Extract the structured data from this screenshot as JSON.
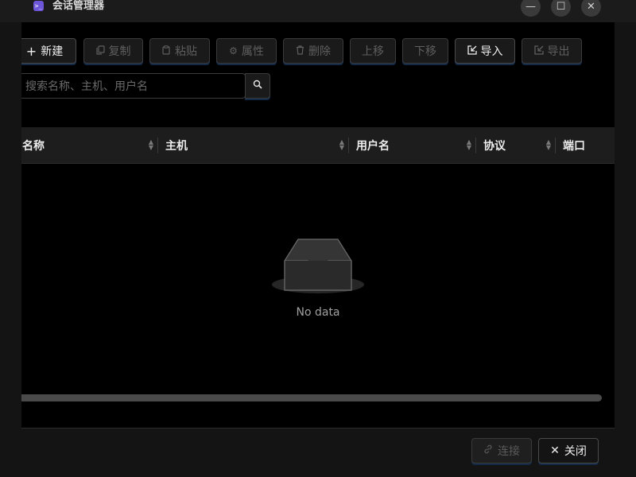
{
  "window": {
    "title": "会话管理器",
    "app_icon": ">_",
    "controls": {
      "minimize": "—",
      "maximize": "☐",
      "close": "✕"
    }
  },
  "toolbar": {
    "new": {
      "icon": "+",
      "label": "新建",
      "enabled": true
    },
    "copy": {
      "icon": "🗍",
      "label": "复制",
      "enabled": false
    },
    "paste": {
      "icon": "🗐",
      "label": "粘贴",
      "enabled": false
    },
    "properties": {
      "icon": "⚙",
      "label": "属性",
      "enabled": false
    },
    "delete": {
      "icon": "🗑",
      "label": "删除",
      "enabled": false
    },
    "move_up": {
      "label": "上移",
      "enabled": false
    },
    "move_down": {
      "label": "下移",
      "enabled": false
    },
    "import": {
      "icon": "⇱",
      "label": "导入",
      "enabled": true
    },
    "export": {
      "icon": "⇱",
      "label": "导出",
      "enabled": false
    }
  },
  "search": {
    "placeholder": "搜索名称、主机、用户名",
    "value": ""
  },
  "table": {
    "columns": [
      {
        "label": "名称",
        "sortable": true
      },
      {
        "label": "主机",
        "sortable": true
      },
      {
        "label": "用户名",
        "sortable": true
      },
      {
        "label": "协议",
        "sortable": true
      },
      {
        "label": "端口",
        "sortable": false
      }
    ],
    "rows": [],
    "empty_text": "No data"
  },
  "footer": {
    "connect": {
      "icon": "🔗",
      "label": "连接",
      "enabled": false
    },
    "close": {
      "icon": "✕",
      "label": "关闭",
      "enabled": true
    }
  },
  "colors": {
    "accent": "#6d55d8",
    "panel_bg": "#000000",
    "window_bg": "#141414"
  }
}
